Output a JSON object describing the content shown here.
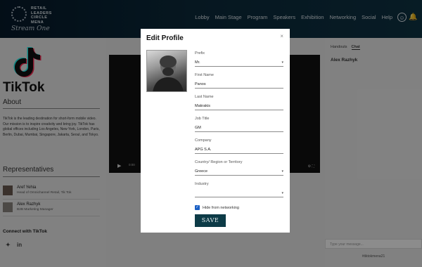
{
  "header": {
    "logo_lines": [
      "RETAIL",
      "LEADERS",
      "CIRCLE",
      "MENA"
    ],
    "logo_script": "Stream One",
    "nav": [
      "Lobby",
      "Main Stage",
      "Program",
      "Speakers",
      "Exhibition",
      "Networking",
      "Social",
      "Help"
    ],
    "icons": [
      "user-icon",
      "bell-icon"
    ]
  },
  "sidebar": {
    "brand": "TikTok",
    "about_heading": "About",
    "about_text": "TikTok is the leading destination for short-form mobile video. Our mission is to inspire creativity and bring joy. TikTok has global offices including Los Angeles, New York, London, Paris, Berlin, Dubai, Mumbai, Singapore, Jakarta, Seoul, and Tokyo.",
    "reps_heading": "Representatives",
    "reps": [
      {
        "name": "Aref Yehia",
        "role": "Head of Omnichannel Retail, Tik Tok"
      },
      {
        "name": "Alex Razhyk",
        "role": "B2B Marketing Manager"
      }
    ],
    "connect_heading": "Connect with TikTok",
    "social": {
      "twitter": "twitter-icon",
      "linkedin": "in"
    }
  },
  "video": {
    "time": "0:00",
    "play_icon": "play-icon"
  },
  "chat": {
    "tabs": [
      "Handouts",
      "Chat"
    ],
    "active_tab": "Chat",
    "user": "Alex Razhyk",
    "input_placeholder": "Type your message...",
    "handle": "#tiktokmena21"
  },
  "modal": {
    "title": "Edit Profile",
    "close_icon": "×",
    "fields": [
      {
        "label": "Prefix",
        "value": "Mr.",
        "type": "select"
      },
      {
        "label": "First Name",
        "value": "Panos",
        "type": "text"
      },
      {
        "label": "Last Name",
        "value": "Makrakis",
        "type": "text"
      },
      {
        "label": "Job Title",
        "value": "GM",
        "type": "text"
      },
      {
        "label": "Company",
        "value": "APG S.A.",
        "type": "text"
      },
      {
        "label": "Country/ Region or Territory",
        "value": "Greece",
        "type": "select"
      },
      {
        "label": "Industry",
        "value": "",
        "type": "select"
      }
    ],
    "hide_networking_label": "Hide from networking",
    "hide_networking_checked": true,
    "save_label": "SAVE"
  },
  "colors": {
    "header_bg": "#0b2a3b",
    "save_bg": "#0d3b47",
    "checkbox": "#1a5fc4"
  }
}
